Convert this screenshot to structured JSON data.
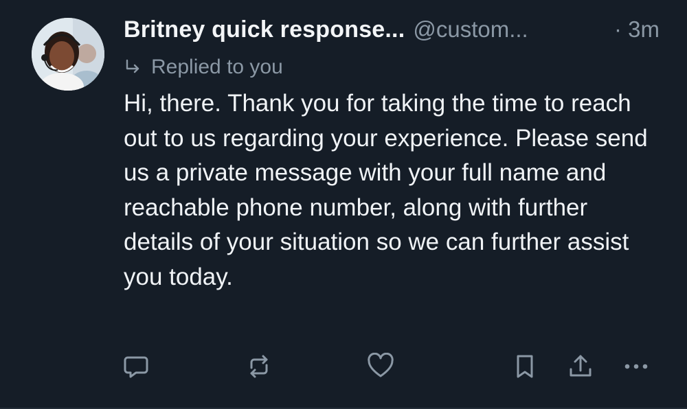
{
  "tweet": {
    "display_name": "Britney quick response...",
    "handle": "@custom...",
    "time": "· 3m",
    "replied_label": "Replied to you",
    "body": "Hi, there. Thank you for taking the time to reach out to us regarding your experience. Please send us a private message with your full name and reachable phone number, along with further details of your situation so we can further assist you today."
  },
  "icons": {
    "avatar": "avatar-photo",
    "replied": "reply-arrow-icon",
    "reply": "comment-icon",
    "retweet": "retweet-icon",
    "like": "heart-icon",
    "bookmark": "bookmark-icon",
    "share": "share-icon",
    "more": "more-icon"
  },
  "colors": {
    "background": "#151d27",
    "text_primary": "#f0f3f6",
    "text_secondary": "#8b98a5",
    "icon": "#8b98a5"
  }
}
